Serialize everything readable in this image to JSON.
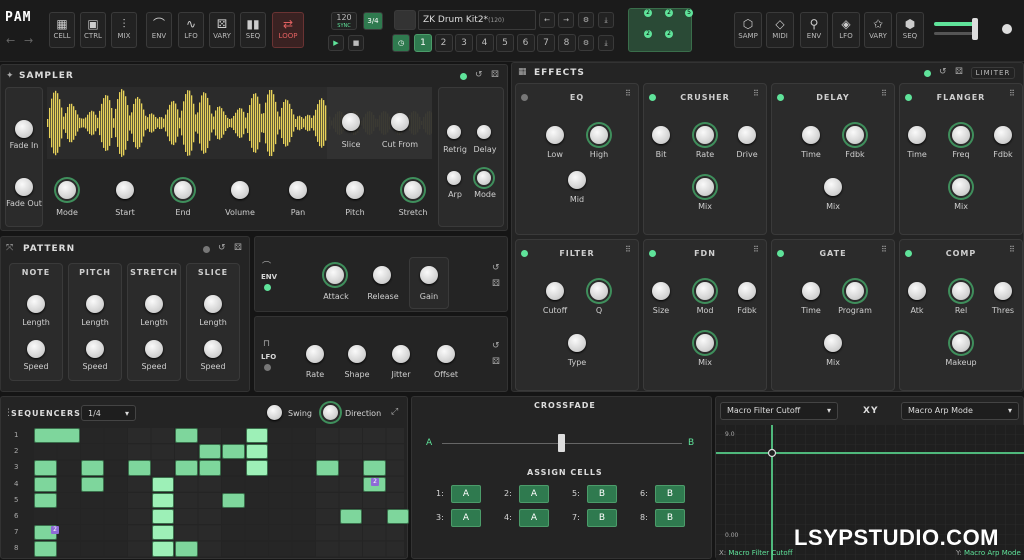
{
  "topbar": {
    "logo": "PAM",
    "tools": [
      {
        "label": "CELL",
        "icon": "grid-icon"
      },
      {
        "label": "CTRL",
        "icon": "square-icon"
      },
      {
        "label": "MIX",
        "icon": "sliders-icon"
      },
      {
        "label": "ENV",
        "icon": "envelope-icon"
      },
      {
        "label": "LFO",
        "icon": "wave-icon"
      },
      {
        "label": "VARY",
        "icon": "dice-icon"
      },
      {
        "label": "SEQ",
        "icon": "bars-icon"
      },
      {
        "label": "LOOP",
        "icon": "loop-icon"
      }
    ],
    "tempo": "120",
    "tempo_sub": "SYNC",
    "time_sig": "3/4",
    "kit_name": "ZK Drum Kit2*",
    "kit_count": "(120)",
    "pages": [
      "1",
      "2",
      "3",
      "4",
      "5",
      "6",
      "7",
      "8"
    ],
    "right_tools": [
      {
        "label": "SAMP",
        "icon": "cube-icon"
      },
      {
        "label": "MIDI",
        "icon": "diamond-icon"
      },
      {
        "label": "ENV",
        "icon": "search-icon"
      },
      {
        "label": "LFO",
        "icon": "diamond-icon"
      },
      {
        "label": "VARY",
        "icon": "star-icon"
      },
      {
        "label": "SEQ",
        "icon": "hexagon-icon"
      }
    ]
  },
  "sampler": {
    "title": "SAMPLER",
    "fade_in": "Fade In",
    "fade_out": "Fade Out",
    "slice": "Slice",
    "cut_from": "Cut From",
    "knobs": [
      "Mode",
      "Start",
      "End",
      "Volume",
      "Pan",
      "Pitch",
      "Stretch"
    ],
    "side": [
      "Retrig",
      "Delay",
      "Arp",
      "Mode"
    ]
  },
  "pattern": {
    "title": "PATTERN",
    "cols": [
      "NOTE",
      "PITCH",
      "STRETCH",
      "SLICE"
    ],
    "rows": [
      "Length",
      "Speed"
    ]
  },
  "env": {
    "label": "ENV",
    "knobs": [
      "Attack",
      "Release",
      "Gain"
    ]
  },
  "lfo": {
    "label": "LFO",
    "knobs": [
      "Rate",
      "Shape",
      "Jitter",
      "Offset"
    ]
  },
  "effects": {
    "title": "EFFECTS",
    "limiter": "LIMITER",
    "cards": [
      {
        "name": "EQ",
        "knobs": [
          "Low",
          "High",
          "Mid"
        ]
      },
      {
        "name": "CRUSHER",
        "knobs": [
          "Bit",
          "Rate",
          "Drive",
          "Mix"
        ]
      },
      {
        "name": "DELAY",
        "knobs": [
          "Time",
          "Fdbk",
          "Mix"
        ]
      },
      {
        "name": "FLANGER",
        "knobs": [
          "Time",
          "Freq",
          "Fdbk",
          "Mix"
        ]
      },
      {
        "name": "FILTER",
        "knobs": [
          "Cutoff",
          "Q",
          "Type"
        ]
      },
      {
        "name": "FDN",
        "knobs": [
          "Size",
          "Mod",
          "Fdbk",
          "Mix"
        ]
      },
      {
        "name": "GATE",
        "knobs": [
          "Time",
          "Program",
          "Mix"
        ]
      },
      {
        "name": "COMP",
        "knobs": [
          "Atk",
          "Rel",
          "Thres",
          "Makeup"
        ]
      }
    ]
  },
  "sequencers": {
    "title": "SEQUENCERS",
    "rate": "1/4",
    "swing": "Swing",
    "direction": "Direction",
    "rows": [
      "1",
      "2",
      "3",
      "4",
      "5",
      "6",
      "7",
      "8"
    ],
    "badge_a": "2",
    "badge_b": "2"
  },
  "crossfade": {
    "title": "CROSSFADE",
    "a": "A",
    "b": "B",
    "assign_title": "ASSIGN CELLS",
    "assign": [
      {
        "n": "1:",
        "v": "A"
      },
      {
        "n": "2:",
        "v": "A"
      },
      {
        "n": "5:",
        "v": "B"
      },
      {
        "n": "6:",
        "v": "B"
      },
      {
        "n": "3:",
        "v": "A"
      },
      {
        "n": "4:",
        "v": "A"
      },
      {
        "n": "7:",
        "v": "B"
      },
      {
        "n": "8:",
        "v": "B"
      }
    ]
  },
  "xy": {
    "title": "XY",
    "x_select": "Macro Filter Cutoff",
    "y_select": "Macro Arp Mode",
    "y_max": "9.0",
    "y_min": "0.00",
    "x_label_prefix": "X:",
    "x_label": "Macro Filter Cutoff",
    "y_label_prefix": "Y:",
    "y_label": "Macro Arp Mode"
  },
  "watermark": "LSYPSTUDIO.COM",
  "colors": {
    "accent": "#5fe39a",
    "waveform": "#e8d25a",
    "panel": "#242424"
  }
}
